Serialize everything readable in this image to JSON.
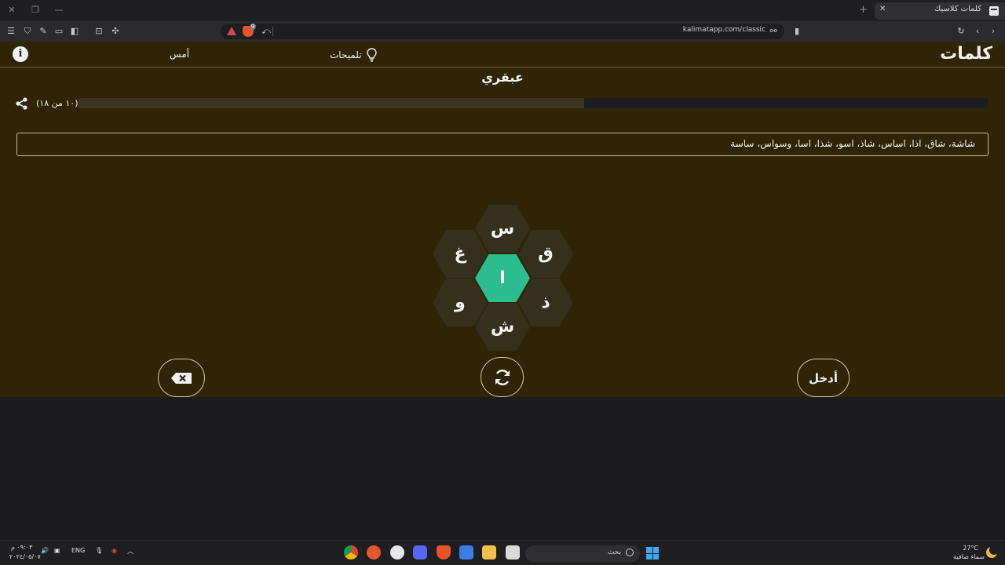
{
  "browser": {
    "tab_title": "كلمات كلاسيك",
    "url": "kalimatapp.com/classic"
  },
  "game": {
    "logo": "كلمات",
    "hints_label": "تلميحات",
    "yesterday_label": "أمس",
    "rank": "عبقري",
    "count": "(١٠ من ١٨)",
    "progress_fraction": 0.556,
    "found_words": "شاشة، شاق، اذا، اساس، شاذ، اسو، شذا، اسا، وسواس، ساسة",
    "letters": {
      "top": "س",
      "upper_left": "غ",
      "upper_right": "ق",
      "center": "ا",
      "lower_left": "و",
      "lower_right": "ذ",
      "bottom": "ش"
    },
    "enter_label": "أدخل"
  },
  "taskbar": {
    "weather_temp": "27°C",
    "weather_desc": "سماء صافية",
    "search_label": "بحث",
    "lang": "ENG",
    "clock_time": "٠٩:٠٣ م",
    "clock_date": "٢٠٢٤/٠٥/٠٧"
  },
  "colors": {
    "page_bg": "#2f2506",
    "hex_bg": "#35301c",
    "center_hex": "#2bbd8e",
    "progress_track": "#3d3522",
    "progress_remaining": "#1d1e22"
  }
}
